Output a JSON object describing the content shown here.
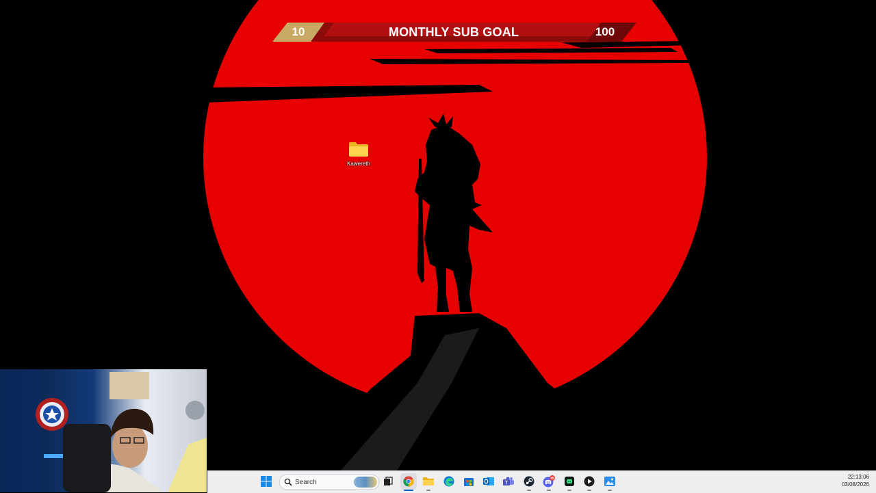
{
  "overlay": {
    "goal_current": "10",
    "goal_title": "MONTHLY SUB GOAL",
    "goal_target": "100"
  },
  "desktop": {
    "icons": [
      {
        "label": "Kawereth",
        "icon": "folder-icon"
      }
    ]
  },
  "taskbar": {
    "search_placeholder": "Search",
    "pinned": [
      {
        "name": "start-button",
        "icon": "windows-logo-icon"
      },
      {
        "name": "task-view-button",
        "icon": "task-view-icon"
      },
      {
        "name": "chrome-button",
        "icon": "chrome-icon",
        "active": true
      },
      {
        "name": "file-explorer-button",
        "icon": "folder-icon"
      },
      {
        "name": "edge-button",
        "icon": "edge-icon"
      },
      {
        "name": "microsoft-store-button",
        "icon": "store-icon"
      },
      {
        "name": "outlook-button",
        "icon": "outlook-icon"
      },
      {
        "name": "teams-button",
        "icon": "teams-icon"
      },
      {
        "name": "steam-button",
        "icon": "steam-icon"
      },
      {
        "name": "discord-button",
        "icon": "discord-icon",
        "badge": "99"
      },
      {
        "name": "app-button",
        "icon": "app-icon"
      },
      {
        "name": "media-player-button",
        "icon": "play-icon"
      },
      {
        "name": "photos-button",
        "icon": "photos-icon"
      }
    ],
    "clock": {
      "time": "22:13:06",
      "date": "03/08/2026"
    }
  },
  "colors": {
    "sun_red": "#e60000",
    "goal_accent": "#c9a864",
    "goal_bar": "#a00c0c",
    "taskbar_bg": "#eeeef0",
    "accent_blue": "#0a64c8"
  }
}
